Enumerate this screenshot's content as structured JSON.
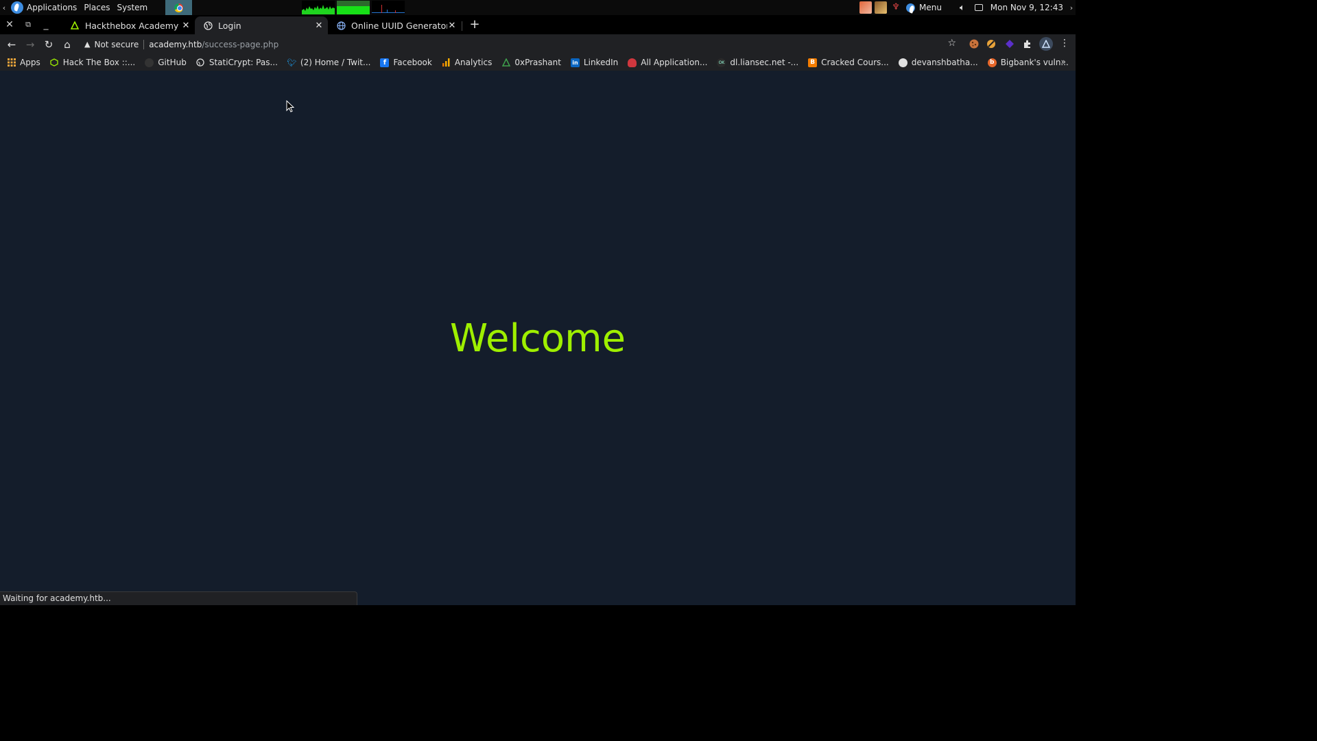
{
  "panel": {
    "menus": [
      "Applications",
      "Places",
      "System"
    ],
    "menu_label": "Menu",
    "clock": "Mon Nov 9, 12:43"
  },
  "tabs": [
    {
      "title": "Hackthebox Academy writ",
      "active": false
    },
    {
      "title": "Login",
      "active": true
    },
    {
      "title": "Online UUID Generator To",
      "active": false
    }
  ],
  "address": {
    "security": "Not secure",
    "host": "academy.htb",
    "path": "/success-page.php"
  },
  "bookmarks": [
    {
      "label": "Apps",
      "icon": "apps-grid-icon"
    },
    {
      "label": "Hack The Box ::...",
      "icon": "htb-cube-icon"
    },
    {
      "label": "GitHub",
      "icon": "github-icon"
    },
    {
      "label": "StatiCrypt: Pas...",
      "icon": "staticrypt-icon"
    },
    {
      "label": "(2) Home / Twit...",
      "icon": "twitter-icon"
    },
    {
      "label": "Facebook",
      "icon": "facebook-icon"
    },
    {
      "label": "Analytics",
      "icon": "analytics-icon"
    },
    {
      "label": "0xPrashant",
      "icon": "htb-icon"
    },
    {
      "label": "LinkedIn",
      "icon": "linkedin-icon"
    },
    {
      "label": "All Application...",
      "icon": "app-icon"
    },
    {
      "label": "dl.liansec.net -...",
      "icon": "liansec-icon"
    },
    {
      "label": "Cracked Cours...",
      "icon": "blogger-icon"
    },
    {
      "label": "devanshbatha...",
      "icon": "github-icon"
    },
    {
      "label": "Bigbank's vuln...",
      "icon": "bigbank-icon"
    }
  ],
  "page": {
    "heading": "Welcome"
  },
  "status_bar": "Waiting for academy.htb...",
  "colors": {
    "page_bg": "#141d2b",
    "accent": "#9fef00",
    "chrome_bg": "#202124"
  }
}
